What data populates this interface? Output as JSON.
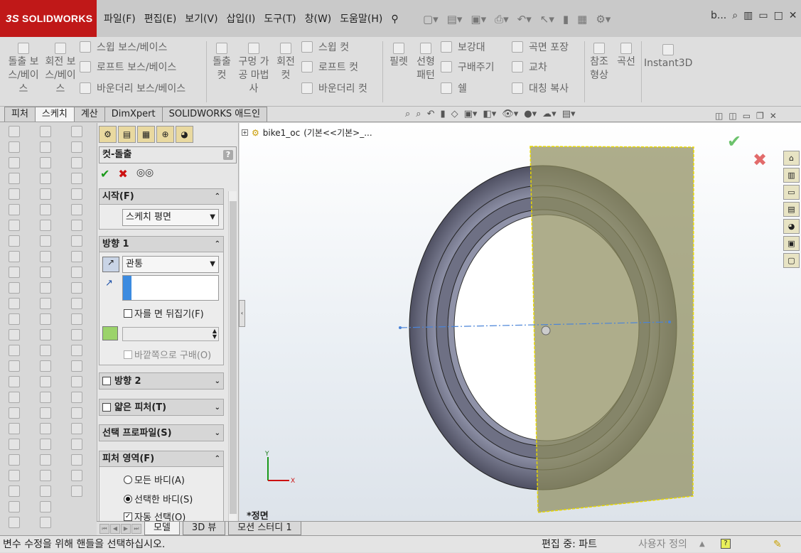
{
  "app": {
    "logo_mark": "3S",
    "logo_text": "SOLIDWORKS"
  },
  "menu": [
    "파일(F)",
    "편집(E)",
    "보기(V)",
    "삽입(I)",
    "도구(T)",
    "창(W)",
    "도움말(H)"
  ],
  "window_title": "b...",
  "ribbon": {
    "boss_extrude": "돌출 보스/베이스",
    "boss_revolve": "회전 보스/베이스",
    "sweep_boss": "스윕 보스/베이스",
    "loft_boss": "로프트 보스/베이스",
    "boundary_boss": "바운더리 보스/베이스",
    "cut_extrude": "돌출 컷",
    "hole_wizard": "구멍 가공 마법사",
    "cut_revolve": "회전 컷",
    "sweep_cut": "스윕 컷",
    "loft_cut": "로프트 컷",
    "boundary_cut": "바운더리 컷",
    "fillet": "필렛",
    "linear_pattern": "선형 패턴",
    "rib": "보강대",
    "draft": "구배주기",
    "shell": "쉘",
    "wrap": "곡면 포장",
    "intersect": "교차",
    "mirror": "대칭 복사",
    "ref_geometry": "참조 형상",
    "curves": "곡선",
    "instant3d": "Instant3D"
  },
  "tabs": [
    "피처",
    "스케치",
    "계산",
    "DimXpert",
    "SOLIDWORKS 애드인"
  ],
  "active_tab": "스케치",
  "property_manager": {
    "title": "컷-돌출",
    "help": "?",
    "from_group": {
      "title": "시작(F)",
      "value": "스케치 평면"
    },
    "dir1_group": {
      "title": "방향 1",
      "end_condition": "관통",
      "flip_side_label": "자를 면 뒤집기(F)",
      "draft_outward_label": "바깥쪽으로 구배(O)"
    },
    "dir2_group": {
      "title": "방향 2"
    },
    "thin_group": {
      "title": "얇은 피처(T)"
    },
    "selected_contours": {
      "title": "선택 프로파일(S)"
    },
    "feature_scope": {
      "title": "피처 영역(F)",
      "all_bodies": "모든 바디(A)",
      "selected_bodies": "선택한 바디(S)",
      "auto_select": "자동 선택(O)"
    }
  },
  "tree": {
    "root": "bike1_oc",
    "config": "(기본<<기본>_..."
  },
  "view_label": "*정면",
  "axes": {
    "x": "X",
    "y": "Y"
  },
  "bottom_tabs": [
    "모델",
    "3D 뷰",
    "모션 스터디 1"
  ],
  "status": {
    "message": "변수 수정을 위해 핸들을 선택하십시오.",
    "mode": "편집 중: 파트",
    "units": "사용자 정의"
  },
  "colors": {
    "logo_bg": "#c01818",
    "plane_fill": "#8f8e5e",
    "tire": "#5b5c6e",
    "accept": "#1a9a1a",
    "cancel": "#cc1111"
  }
}
